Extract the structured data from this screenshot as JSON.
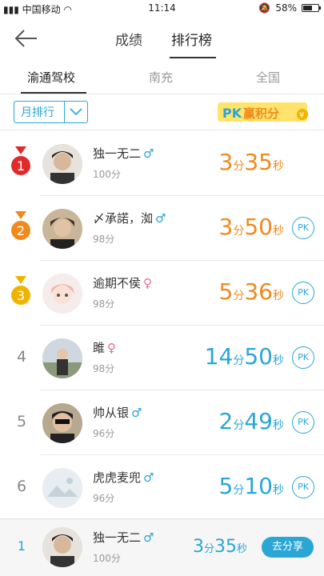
{
  "status_bar": {
    "carrier": "中国移动",
    "time": "11:14",
    "battery": "58%"
  },
  "header": {
    "tabs": [
      "成绩",
      "排行榜"
    ],
    "active_tab": "排行榜"
  },
  "school_tabs": {
    "items": [
      "渝通驾校",
      "南充",
      "全国"
    ],
    "active": "渝通驾校"
  },
  "filter": {
    "period": "月排行",
    "pk_banner": "PK赢积分"
  },
  "rankings": [
    {
      "rank": "1",
      "name": "独一无二",
      "gender": "male",
      "points": "100分",
      "min": "3",
      "min_unit": "分",
      "sec": "35",
      "sec_unit": "秒",
      "color": "orange",
      "pk": ""
    },
    {
      "rank": "2",
      "name": "〆承諾，洳",
      "gender": "male",
      "points": "98分",
      "min": "3",
      "min_unit": "分",
      "sec": "50",
      "sec_unit": "秒",
      "color": "orange",
      "pk": "PK"
    },
    {
      "rank": "3",
      "name": "逾期不侯",
      "gender": "female",
      "points": "98分",
      "min": "5",
      "min_unit": "分",
      "sec": "36",
      "sec_unit": "秒",
      "color": "orange",
      "pk": "PK"
    },
    {
      "rank": "4",
      "name": "雎",
      "gender": "female",
      "points": "98分",
      "min": "14",
      "min_unit": "分",
      "sec": "50",
      "sec_unit": "秒",
      "color": "blue",
      "pk": "PK"
    },
    {
      "rank": "5",
      "name": "帅从银",
      "gender": "male",
      "points": "96分",
      "min": "2",
      "min_unit": "分",
      "sec": "49",
      "sec_unit": "秒",
      "color": "blue",
      "pk": "PK"
    },
    {
      "rank": "6",
      "name": "虎虎麦兜",
      "gender": "male",
      "points": "96分",
      "min": "5",
      "min_unit": "分",
      "sec": "10",
      "sec_unit": "秒",
      "color": "blue",
      "pk": "PK"
    }
  ],
  "my_rank": {
    "rank": "1",
    "name": "独一无二",
    "gender": "male",
    "points": "100分",
    "min": "3",
    "min_unit": "分",
    "sec": "35",
    "sec_unit": "秒",
    "share_label": "去分享"
  },
  "colors": {
    "accent": "#2aa6d6",
    "orange": "#ef8a1c",
    "medal_gold": "#f0b400",
    "medal_red": "#e02b2b",
    "medal_orange": "#f08a1c"
  },
  "icons": {
    "back": "back-arrow-icon",
    "male": "male-symbol",
    "female": "female-symbol",
    "chevron": "chevron-down-icon"
  }
}
